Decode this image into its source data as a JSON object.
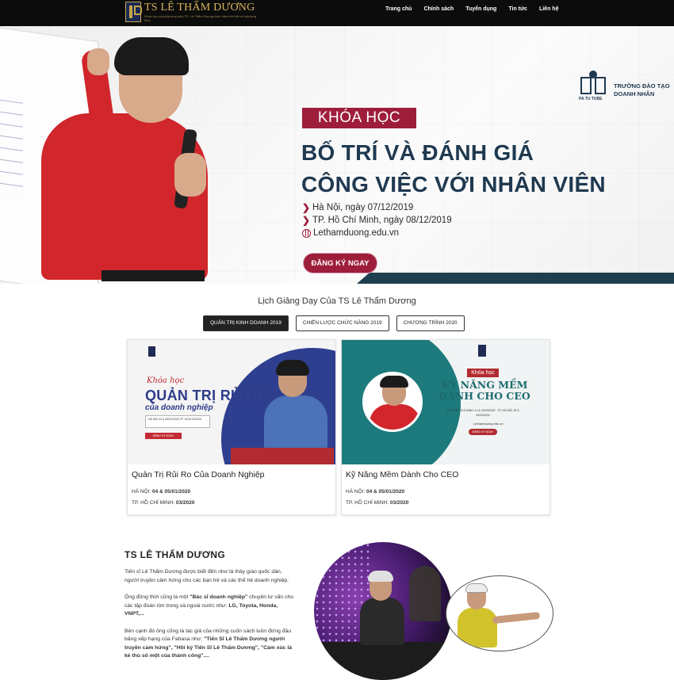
{
  "navbar": {
    "logo_title": "TS LÊ THẨM DƯƠNG",
    "logo_tagline": "Khóa học cùng thương hiệu TS. Lê Thẩm Dương thực hiện bởi Kết nối phương thức",
    "links": [
      "Trang chủ",
      "Chính sách",
      "Tuyển dụng",
      "Tin tức",
      "Liên hệ"
    ]
  },
  "hero": {
    "badge": "KHÓA HỌC",
    "title_line1": "BỐ TRÍ VÀ ĐÁNH GIÁ",
    "title_line2": "CÔNG VIỆC VỚI NHÂN VIÊN",
    "info_hanoi": "Hà Nội, ngày 07/12/2019",
    "info_hcm": "TP. Hồ Chí Minh, ngày 08/12/2019",
    "website": "Lethamduong.edu.vn",
    "cta": "ĐĂNG KÝ NGAY",
    "school_logo_text": "PA TU TUBE",
    "school_line1": "TRƯỜNG ĐÀO TẠO",
    "school_line2": "DOANH NHÂN",
    "colors": {
      "accent": "#9e1d3b",
      "title": "#1f3950"
    }
  },
  "schedule": {
    "title": "Lịch Giảng Dạy Của TS Lê Thẩm Dương",
    "tabs": [
      "QUẢN TRỊ KINH DOANH 2019",
      "CHIẾN LƯỢC CHỨC NĂNG 2019",
      "CHƯƠNG TRÌNH 2020"
    ],
    "active_tab": "QUẢN TRỊ KINH DOANH 2019",
    "cards": [
      {
        "title": "Quản Trị Rủi Ro Của Doanh Nghiệp",
        "hanoi_label": "HÀ NỘI:",
        "hanoi_date": "04 & 05/01/2020",
        "hcm_label": "TP. HỒ CHÍ MINH:",
        "hcm_date": "03/2020",
        "img_script": "Khóa học",
        "img_main": "QUẢN TRỊ RỦI RO",
        "img_sub": "của doanh nghiệp",
        "img_box": "HÀ NỘI 04 & 05/01/2020   TP. HCM 03/2020",
        "img_btn": "ĐĂNG KÝ NGAY"
      },
      {
        "title": "Kỹ Năng Mềm Dành Cho CEO",
        "hanoi_label": "HÀ NỘI:",
        "hanoi_date": "04 & 05/01/2020",
        "hcm_label": "TP. HỒ CHÍ MINH:",
        "hcm_date": "03/2020",
        "img_badge": "Khóa học",
        "img_main_line1": "KỸ NĂNG MỀM",
        "img_main_line2": "DÀNH CHO CEO",
        "img_info": "TS TP. HỒ CHÍ MINH: 14 & 15/03/2020 · TP. HÀ NỘI: 28 & 29/03/2020",
        "img_web": "Lethamduong.edu.vn",
        "img_btn": "ĐĂNG KÝ NGAY"
      }
    ]
  },
  "about": {
    "title": "TS LÊ THẨM DƯƠNG",
    "p1": "Tiến sĩ Lê Thẩm Dương được biết đến như là thầy giáo quốc dân, người truyền cảm hứng cho các bạn trẻ và các thế hệ doanh nghiệp.",
    "p2_pre": "Ông đồng thời cũng là một ",
    "p2_bold": "\"Bác sĩ doanh nghiệp\"",
    "p2_post": " chuyên tư vấn cho các tập đoàn lớn trong và ngoài nước như: ",
    "p2_brands": "LG, Toyota, Honda, VNPT,...",
    "p3_pre": "Bên cạnh đó ông cũng là tác giả của những cuốn sách luôn đứng đầu bảng xếp hạng của Fahasa như: ",
    "p3_bold": "\"Tiến Sĩ Lê Thẩm Dương người truyền cảm hứng\", \"Hồi ký Tiến Sĩ Lê Thẩm Dương\", \"Cảm xúc là kẻ thù số một của thành công\"...."
  }
}
